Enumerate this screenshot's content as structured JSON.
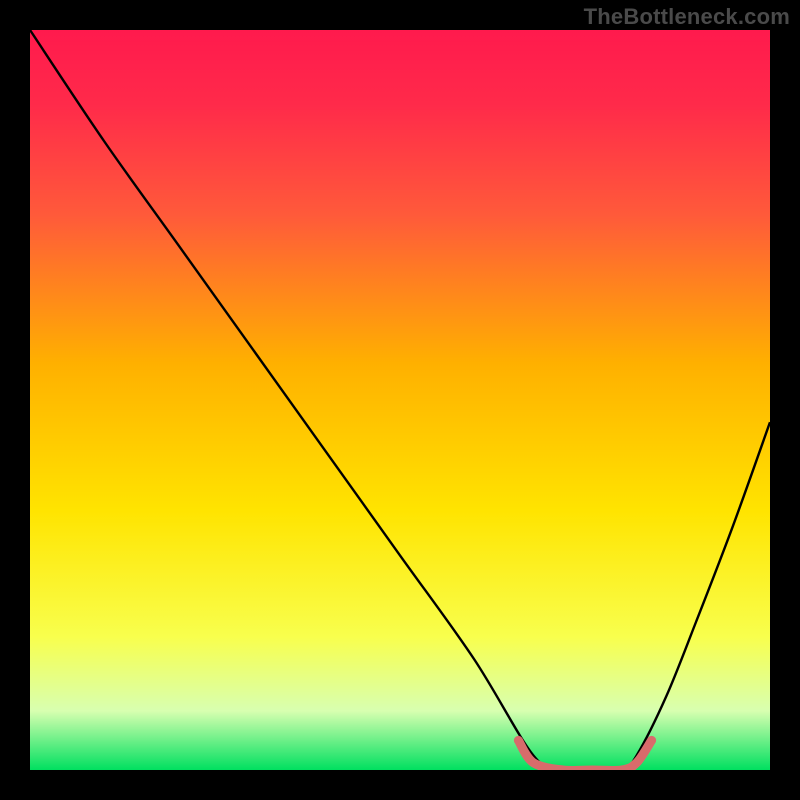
{
  "attribution": "TheBottleneck.com",
  "chart_data": {
    "type": "line",
    "title": "",
    "xlabel": "",
    "ylabel": "",
    "xlim": [
      0,
      100
    ],
    "ylim": [
      0,
      100
    ],
    "optimum_x_range": [
      68,
      82
    ],
    "curve": {
      "name": "bottleneck-curve",
      "x": [
        0,
        10,
        20,
        30,
        40,
        50,
        60,
        68,
        72,
        76,
        80,
        82,
        86,
        90,
        95,
        100
      ],
      "y": [
        100,
        85,
        71,
        57,
        43,
        29,
        15,
        2,
        0,
        0,
        0,
        2,
        10,
        20,
        33,
        47
      ]
    },
    "highlight_segment": {
      "name": "optimum-band",
      "x": [
        66,
        68,
        72,
        76,
        80,
        82,
        84
      ],
      "y": [
        4,
        1,
        0,
        0,
        0,
        1,
        4
      ]
    },
    "background_gradient": {
      "stops": [
        {
          "pos": 0.0,
          "color": "#ff1a4d"
        },
        {
          "pos": 0.1,
          "color": "#ff2a4a"
        },
        {
          "pos": 0.25,
          "color": "#ff5a3a"
        },
        {
          "pos": 0.45,
          "color": "#ffb000"
        },
        {
          "pos": 0.65,
          "color": "#ffe400"
        },
        {
          "pos": 0.82,
          "color": "#f8ff4d"
        },
        {
          "pos": 0.92,
          "color": "#d8ffb0"
        },
        {
          "pos": 1.0,
          "color": "#00e060"
        }
      ]
    },
    "colors": {
      "curve": "#000000",
      "highlight": "#d86b6b"
    }
  }
}
